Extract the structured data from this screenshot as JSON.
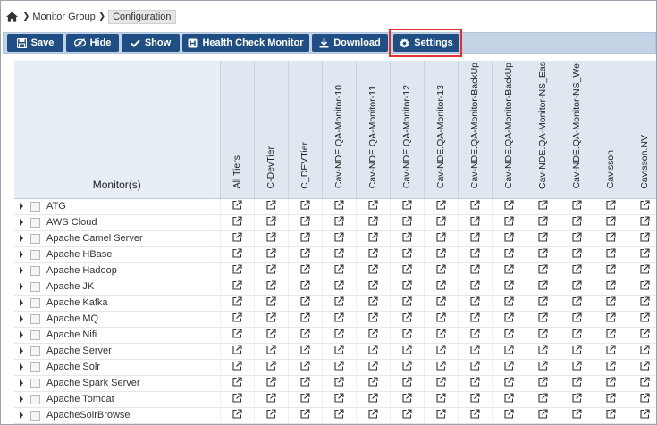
{
  "breadcrumb": {
    "items": [
      "Monitor Group",
      "Configuration"
    ]
  },
  "toolbar": {
    "save_label": "Save",
    "hide_label": "Hide",
    "show_label": "Show",
    "health_check_label": "Health Check Monitor",
    "download_label": "Download",
    "settings_label": "Settings"
  },
  "table": {
    "monitor_header": "Monitor(s)",
    "columns": [
      "All Tiers",
      "C-DevTier",
      "C_DEVTier",
      "Cav-NDE.QA-Monitor-10",
      "Cav-NDE.QA-Monitor-11",
      "Cav-NDE.QA-Monitor-12",
      "Cav-NDE.QA-Monitor-13",
      "Cav-NDE.QA-Monitor-BackUp",
      "Cav-NDE.QA-Monitor-BackUp",
      "Cav-NDE.QA-Monitor-NS_Eas",
      "Cav-NDE.QA-Monitor-NS_We",
      "Cavisson",
      "Cavisson.NV"
    ],
    "rows": [
      "ATG",
      "AWS Cloud",
      "Apache Camel Server",
      "Apache HBase",
      "Apache Hadoop",
      "Apache JK",
      "Apache Kafka",
      "Apache MQ",
      "Apache Nifi",
      "Apache Server",
      "Apache Solr",
      "Apache Spark Server",
      "Apache Tomcat",
      "ApacheSolrBrowse"
    ]
  },
  "colors": {
    "button_bg": "#1f4e85",
    "toolbar_bg": "#c3d3e6",
    "header_bg": "#dfe7f0",
    "highlight": "#e53030"
  },
  "icons": {
    "home": "home-icon",
    "edit": "external-edit-icon"
  }
}
